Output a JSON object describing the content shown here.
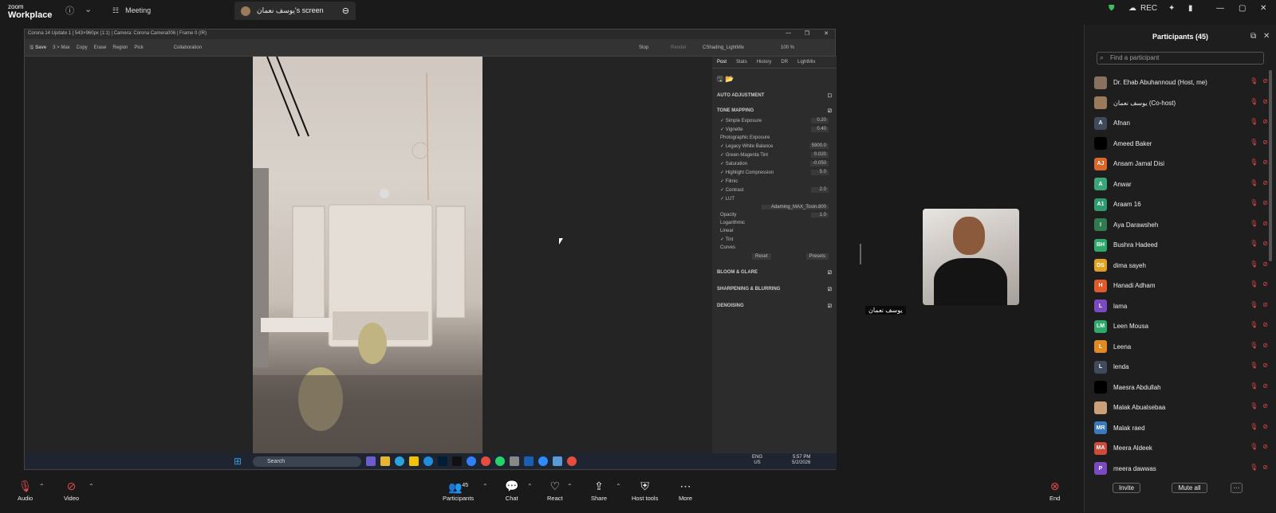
{
  "app": {
    "logo_line1": "zoom",
    "logo_line2": "Workplace",
    "meeting_label": "Meeting",
    "share_tab": "يوسف نعمان's screen",
    "rec": "REC"
  },
  "corona": {
    "title": "Corona 14 Update 1 | 543×960px (1:1) | Camera: Corona Camera006 | Frame 0 (IR)",
    "toolbar": {
      "save": "Save",
      "max": "3 > Max",
      "copy": "Copy",
      "erase": "Erase",
      "region": "Region",
      "pick": "Pick",
      "collab": "Collaboration",
      "stop": "Stop",
      "render": "Render",
      "lightmix": "CShading_LightMix",
      "zoom": "100 %"
    },
    "tabs": [
      "Post",
      "Stats",
      "History",
      "DR",
      "LightMix"
    ],
    "sections": {
      "auto": "AUTO ADJUSTMENT",
      "tone": "TONE MAPPING",
      "bloom": "BLOOM & GLARE",
      "sharp": "SHARPENING & BLURRING",
      "denoise": "DENOISING"
    },
    "tone_rows": [
      {
        "label": "✓ Simple Exposure",
        "value": "0.20"
      },
      {
        "label": "✓ Vignette",
        "value": "0.40"
      },
      {
        "label": "Photographic Exposure",
        "value": ""
      },
      {
        "label": "✓ Legacy White Balance",
        "value": "5900.0"
      },
      {
        "label": "✓ Green-Magenta Tint",
        "value": "0.020"
      },
      {
        "label": "✓ Saturation",
        "value": "-0.050"
      },
      {
        "label": "✓ Highlight Compression",
        "value": "5.0"
      },
      {
        "label": "✓ Filmic",
        "value": ""
      },
      {
        "label": "✓ Contrast",
        "value": "2.0"
      },
      {
        "label": "✓ LUT",
        "value": ""
      }
    ],
    "lut_file": "Adaming_MAX_Tosin.800",
    "lut_rows": [
      {
        "label": "Opacity",
        "value": "1.0"
      },
      {
        "label": "Logarithmic",
        "value": ""
      },
      {
        "label": "Linear",
        "value": ""
      }
    ],
    "after_rows": [
      {
        "label": "✓ Tint",
        "value": ""
      },
      {
        "label": "Curves",
        "value": ""
      }
    ],
    "buttons": {
      "reset": "Reset",
      "presets": "Presets"
    }
  },
  "taskbar": {
    "search": "Search",
    "lang1": "ENG",
    "lang2": "US",
    "time": "5:57 PM",
    "date": "5/2/2026"
  },
  "video": {
    "name": "يوسف نعمان"
  },
  "participants": {
    "title": "Participants (45)",
    "find_placeholder": "Find a participant",
    "list": [
      {
        "name": "Dr. Ehab Abuhannoud (Host, me)",
        "initials": "",
        "color": "#8a7060"
      },
      {
        "name": "يوسف نعمان (Co-host)",
        "initials": "",
        "color": "#9b7a5c"
      },
      {
        "name": "Afnan",
        "initials": "A",
        "color": "#3f4a5a"
      },
      {
        "name": "Ameed Baker",
        "initials": "",
        "color": "#000000"
      },
      {
        "name": "Ansam Jamal Disi",
        "initials": "AJ",
        "color": "#d9662b"
      },
      {
        "name": "Anwar",
        "initials": "A",
        "color": "#3aa57a"
      },
      {
        "name": "Araam 16",
        "initials": "A1",
        "color": "#2f9a6e"
      },
      {
        "name": "Aya Darawsheh",
        "initials": "I",
        "color": "#2f7a4e"
      },
      {
        "name": "Bushra Hadeed",
        "initials": "BH",
        "color": "#2ea86b"
      },
      {
        "name": "dima sayeh",
        "initials": "DS",
        "color": "#e0a020"
      },
      {
        "name": "Hanadi Adham",
        "initials": "H",
        "color": "#e05a2a"
      },
      {
        "name": "lama",
        "initials": "L",
        "color": "#7a4ac0"
      },
      {
        "name": "Leen Mousa",
        "initials": "LM",
        "color": "#2ea86b"
      },
      {
        "name": "Leena",
        "initials": "L",
        "color": "#e08a20"
      },
      {
        "name": "lenda",
        "initials": "L",
        "color": "#3f4a5a"
      },
      {
        "name": "Maesra Abdullah",
        "initials": "",
        "color": "#000000"
      },
      {
        "name": "Malak Abualsebaa",
        "initials": "",
        "color": "#c9a07a"
      },
      {
        "name": "Malak raed",
        "initials": "MR",
        "color": "#3a7bc0"
      },
      {
        "name": "Meera Aldeek",
        "initials": "MA",
        "color": "#d04a3a"
      },
      {
        "name": "meera dawwas",
        "initials": "P",
        "color": "#7a4ac0"
      }
    ],
    "invite": "Invite",
    "mute_all": "Mute all"
  },
  "bottom": {
    "audio": "Audio",
    "video": "Video",
    "participants": "Participants",
    "participants_count": "45",
    "chat": "Chat",
    "react": "React",
    "share": "Share",
    "host_tools": "Host tools",
    "more": "More",
    "end": "End"
  },
  "colors": {
    "accent_red": "#e04b4b",
    "bg": "#1a1a1a"
  }
}
